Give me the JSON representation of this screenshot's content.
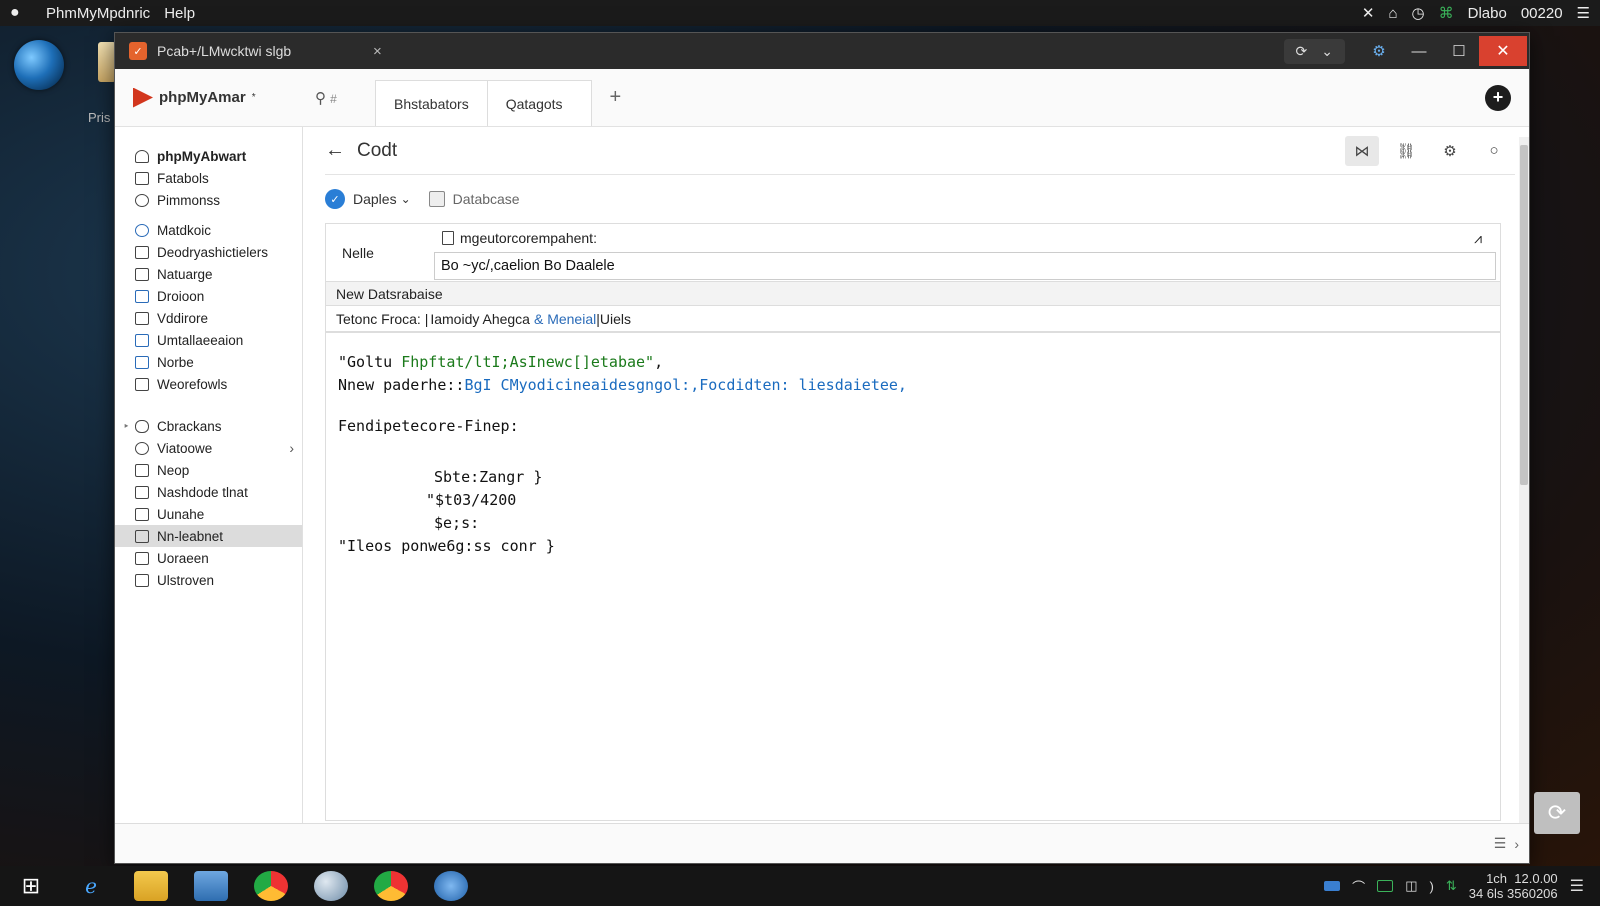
{
  "system_bar": {
    "app_name": "PhmMyMpdnric",
    "menu_help": "Help",
    "user_label": "Dlabo",
    "clock": "00220"
  },
  "desktop": {
    "label": "Pris"
  },
  "window": {
    "tab_title": "Pcab+/LMwcktwi slgb",
    "controls": {
      "minimize": "—",
      "maximize": "☐",
      "close": "✕"
    }
  },
  "header": {
    "logo_text": "phpMyAmar",
    "logo_sup": "*",
    "search_suffix": "#",
    "tabs": [
      "Bhstabators",
      "Qatagots"
    ],
    "add_tab": "+",
    "new_button": "+"
  },
  "sidebar": {
    "items": [
      {
        "label": "phpMyAbwart"
      },
      {
        "label": "Fatabols"
      },
      {
        "label": "Pimmonss"
      },
      {
        "label": "Matdkoic"
      },
      {
        "label": "Deodryashictielers"
      },
      {
        "label": "Natuarge"
      },
      {
        "label": "Droioon"
      },
      {
        "label": "Vddirore"
      },
      {
        "label": "Umtallaeeaion"
      },
      {
        "label": "Norbe"
      },
      {
        "label": "Weorefowls"
      },
      {
        "label": "Cbrackans"
      },
      {
        "label": "Viatoowe"
      },
      {
        "label": "Neop"
      },
      {
        "label": "Nashdode tlnat"
      },
      {
        "label": "Uunahe"
      },
      {
        "label": "Nn-leabnet"
      },
      {
        "label": "Uoraeen"
      },
      {
        "label": "Ulstroven"
      }
    ]
  },
  "main": {
    "title": "Codt",
    "back": "←",
    "subbar": {
      "dropdown": "Daples",
      "database": "Databcase"
    },
    "form": {
      "name_label": "Nelle",
      "field_header": "mgeutorcorempahent:",
      "field_value": "Bo ~yc/,caelion  Bo Daalele",
      "section_label": "New Datsrabaise",
      "row_prefix": "Tetonc Froca: |",
      "row_mid": "Iamoidy  Ahegca",
      "row_link": "& Meneial",
      "row_suffix": "|Uiels"
    },
    "code": {
      "line1_a": "\"Goltu ",
      "line1_b": "Fhpftat/ltI;AsInewc[]etabae\"",
      "line1_c": ",",
      "line2_a": "Nnew paderhe::",
      "line2_b": "BgI CMyodicineaidesgngol:,Focdidten: liesdaietee,",
      "line3": "Fendipetecore-Finep:",
      "line4": "Sbte:Zangr }",
      "line5": "\"$t03/4200",
      "line6": "$e;s:",
      "line7": "\"Ileos ponwe6g:ss conr }"
    }
  },
  "taskbar": {
    "tray_time": "12.0.00",
    "tray_date": "34 6ls 3560206",
    "tray_lang": "1ch"
  }
}
